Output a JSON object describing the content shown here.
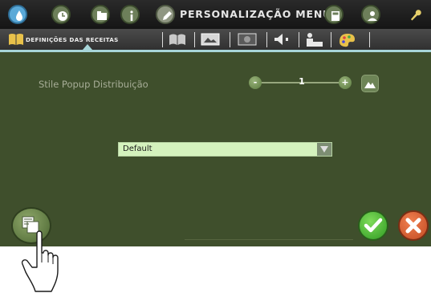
{
  "header": {
    "title": "PERSONALIZAÇÃO MENU",
    "icons": [
      "drop-icon",
      "clock-icon",
      "folder-icon",
      "info-icon",
      "pencil-icon",
      "calculator-icon",
      "user-icon",
      "wrench-icon"
    ]
  },
  "tabs": {
    "active_label": "DEFINIÇÕES DAS RECEITAS",
    "icons": [
      "book-icon",
      "book-open-icon",
      "image-icon",
      "photo-icon",
      "speaker-icon",
      "silhouette-icon",
      "palette-icon"
    ]
  },
  "content": {
    "setting_label": "Stile Popup Distribuição",
    "stepper_value": "1",
    "stepper_minus": "-",
    "stepper_plus": "+",
    "dropdown_value": "Default"
  },
  "colors": {
    "background": "#3f4f2c",
    "accent": "#a8d6d9",
    "confirm": "#2f9a22",
    "cancel": "#c24a22"
  }
}
